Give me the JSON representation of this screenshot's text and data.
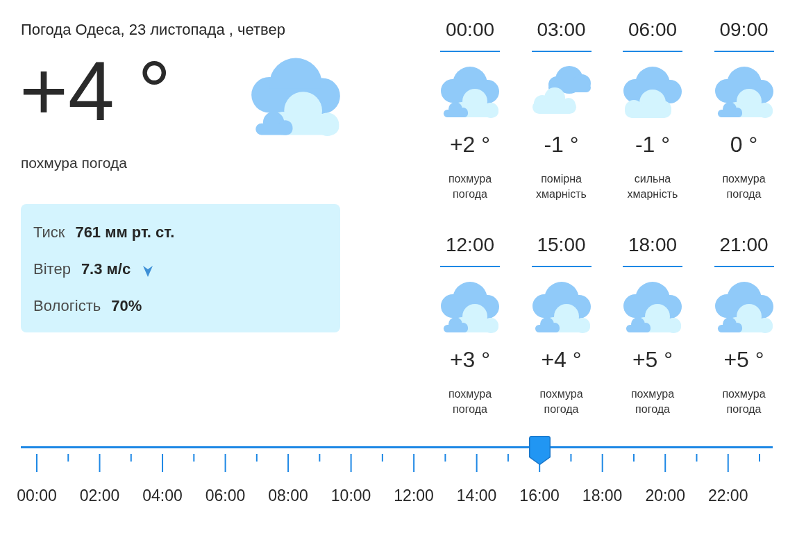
{
  "current": {
    "title": "Погода Одеса, 23 листопада , четвер",
    "temperature": "+4 °",
    "kind": "overcast",
    "condition": "похмура погода",
    "details": [
      {
        "label": "Тиск",
        "value": "761 мм рт. ст.",
        "kind": "plain"
      },
      {
        "label": "Вітер",
        "value": "7.3 м/с",
        "kind": "wind"
      },
      {
        "label": "Вологість",
        "value": "70%",
        "kind": "plain"
      }
    ]
  },
  "hourly": [
    {
      "time": "00:00",
      "kind": "overcast",
      "temperature": "+2 °",
      "condition": "похмура погода"
    },
    {
      "time": "03:00",
      "kind": "partly",
      "temperature": "-1 °",
      "condition": "помірна хмарність"
    },
    {
      "time": "06:00",
      "kind": "cloudy",
      "temperature": "-1 °",
      "condition": "сильна хмарність"
    },
    {
      "time": "09:00",
      "kind": "overcast",
      "temperature": "0 °",
      "condition": "похмура погода"
    },
    {
      "time": "12:00",
      "kind": "overcast",
      "temperature": "+3 °",
      "condition": "похмура погода"
    },
    {
      "time": "15:00",
      "kind": "overcast",
      "temperature": "+4 °",
      "condition": "похмура погода"
    },
    {
      "time": "18:00",
      "kind": "overcast",
      "temperature": "+5 °",
      "condition": "похмура погода"
    },
    {
      "time": "21:00",
      "kind": "overcast",
      "temperature": "+5 °",
      "condition": "похмура погода"
    }
  ],
  "timeline": {
    "labels": [
      "00:00",
      "02:00",
      "04:00",
      "06:00",
      "08:00",
      "10:00",
      "12:00",
      "14:00",
      "16:00",
      "18:00",
      "20:00",
      "22:00"
    ],
    "level": 0.6957
  }
}
